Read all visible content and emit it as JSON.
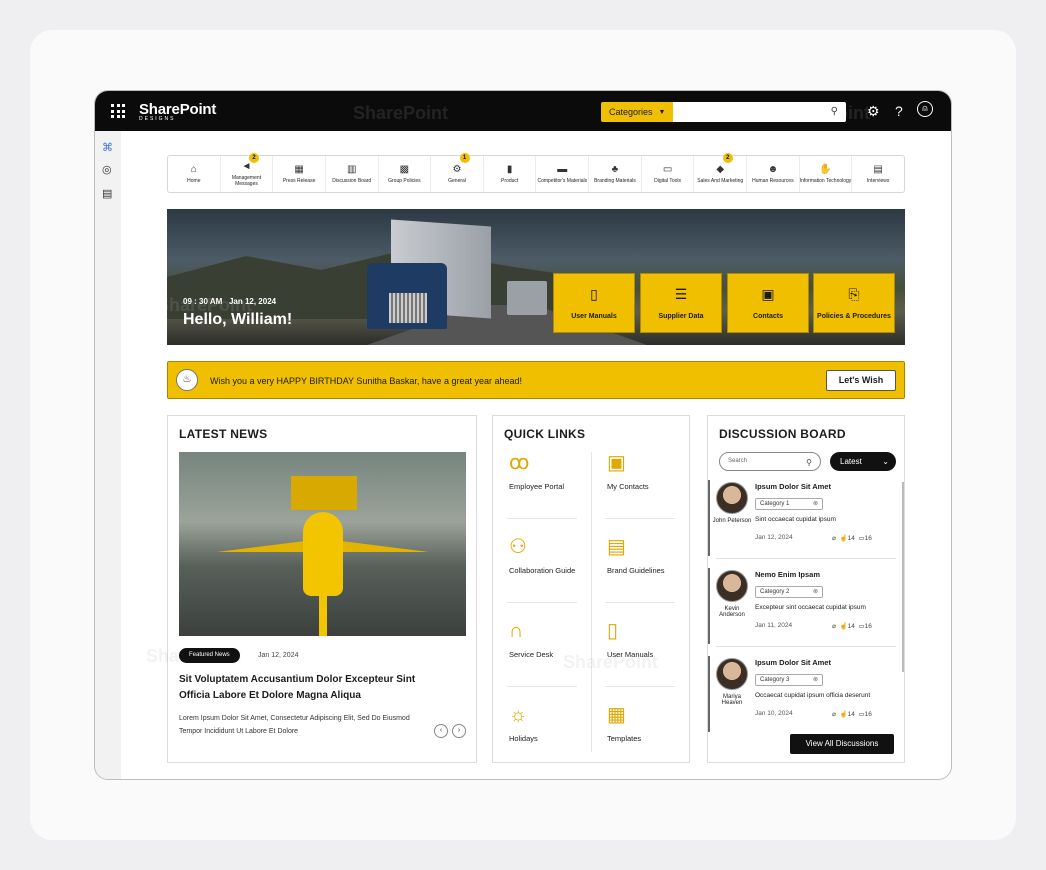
{
  "logo": {
    "name": "SharePoint",
    "sub": "DESIGNS"
  },
  "watermark": "SharePoint",
  "topbar": {
    "categories_label": "Categories",
    "search_placeholder": ""
  },
  "nav": [
    {
      "label": "Home",
      "icon": "home-icon",
      "badge": ""
    },
    {
      "label": "Management Messages",
      "icon": "megaphone-icon",
      "badge": "2"
    },
    {
      "label": "Press Release",
      "icon": "press-icon",
      "badge": ""
    },
    {
      "label": "Discussion Board",
      "icon": "board-icon",
      "badge": ""
    },
    {
      "label": "Group Policies",
      "icon": "book-icon",
      "badge": ""
    },
    {
      "label": "General",
      "icon": "gears-icon",
      "badge": "1"
    },
    {
      "label": "Product",
      "icon": "chart-icon",
      "badge": ""
    },
    {
      "label": "Competitor's Materials",
      "icon": "folder-icon",
      "badge": ""
    },
    {
      "label": "Branding Materials",
      "icon": "org-icon",
      "badge": ""
    },
    {
      "label": "Digital Tools",
      "icon": "monitor-icon",
      "badge": ""
    },
    {
      "label": "Sales And Marketing",
      "icon": "layers-icon",
      "badge": "2"
    },
    {
      "label": "Human Resources",
      "icon": "people-icon",
      "badge": ""
    },
    {
      "label": "Information Technology",
      "icon": "handshake-icon",
      "badge": ""
    },
    {
      "label": "Interviews",
      "icon": "doc-icon",
      "badge": ""
    }
  ],
  "hero": {
    "time": "09 : 30 AM",
    "date": "Jan 12, 2024",
    "greeting": "Hello, William!",
    "tiles": [
      {
        "label": "User Manuals",
        "icon": "manual-icon"
      },
      {
        "label": "Supplier Data",
        "icon": "database-icon"
      },
      {
        "label": "Contacts",
        "icon": "contact-icon"
      },
      {
        "label": "Policies & Procedures",
        "icon": "policy-icon"
      }
    ]
  },
  "birthday": {
    "message": "Wish you a very HAPPY BIRTHDAY Sunitha Baskar, have a great year ahead!",
    "button": "Let's Wish"
  },
  "news": {
    "title": "LATEST NEWS",
    "badge": "Featured News",
    "date": "Jan 12, 2024",
    "headline": "Sit Voluptatem Accusantium Dolor Excepteur Sint Officia Labore Et Dolore Magna Aliqua",
    "description": "Lorem Ipsum Dolor Sit Amet, Consectetur Adipiscing Elit, Sed Do Eiusmod Tempor Incididunt Ut Labore Et Dolore"
  },
  "quick_links": {
    "title": "QUICK LINKS",
    "items": [
      {
        "label": "Employee Portal",
        "icon": "people-icon"
      },
      {
        "label": "My Contacts",
        "icon": "contact-icon"
      },
      {
        "label": "Collaboration Guide",
        "icon": "collaboration-icon"
      },
      {
        "label": "Brand Guidelines",
        "icon": "clipboard-icon"
      },
      {
        "label": "Service Desk",
        "icon": "headset-icon"
      },
      {
        "label": "User Manuals",
        "icon": "manual-icon"
      },
      {
        "label": "Holidays",
        "icon": "beach-icon"
      },
      {
        "label": "Templates",
        "icon": "grid-icon"
      }
    ]
  },
  "discussion": {
    "title": "DISCUSSION BOARD",
    "search_placeholder": "Search",
    "filter": "Latest",
    "items": [
      {
        "author": "John Peterson",
        "title": "Ipsum Dolor Sit Amet",
        "category": "Category 1",
        "text": "Sint occaecat cupidat ipsum",
        "date": "Jan 12, 2024",
        "likes": "14",
        "comments": "16"
      },
      {
        "author": "Kevin Anderson",
        "title": "Nemo Enim Ipsam",
        "category": "Category 2",
        "text": "Excepteur sint occaecat cupidat ipsum",
        "date": "Jan 11, 2024",
        "likes": "14",
        "comments": "16"
      },
      {
        "author": "Mariya Heaven",
        "title": "Ipsum Dolor Sit Amet",
        "category": "Category 3",
        "text": "Occaecat cupidat ipsum officia deserunt",
        "date": "Jan 10, 2024",
        "likes": "14",
        "comments": "16"
      }
    ],
    "view_all": "View All Discussions"
  },
  "colors": {
    "accent": "#f0bf00",
    "dark": "#0b0b0b"
  }
}
